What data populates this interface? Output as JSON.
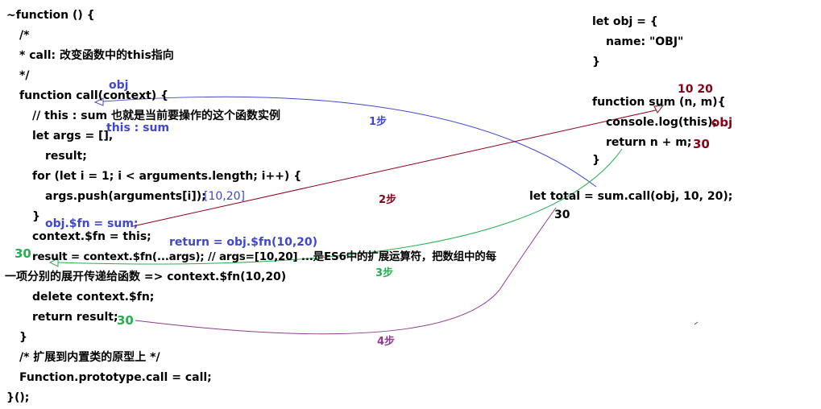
{
  "code_left": [
    "~function () {",
    "/*",
    " *  call: 改变函数中的this指向",
    " */",
    "function call(context) {",
    "// this : sum 也就是当前要操作的这个函数实例",
    "let args = [],",
    "result;",
    "for (let i = 1; i < arguments.length; i++) {",
    "args.push(arguments[i]);",
    "}",
    "context.$fn = this;",
    "result = context.$fn(...args);  // args=[10,20] ...是ES6中的扩展运算符，把数组中的每",
    "一项分别的展开传递给函数 => context.$fn(10,20)",
    "delete context.$fn;",
    "return result;",
    "}",
    "/* 扩展到内置类的原型上 */",
    "Function.prototype.call = call;",
    "}();"
  ],
  "code_right": [
    "let obj = {",
    "name: \"OBJ\"",
    "}",
    "function sum (n, m){",
    "console.log(this);",
    "return n + m;",
    "}",
    "let total = sum.call(obj, 10, 20);"
  ],
  "annotations": {
    "obj_over_context": "obj",
    "this_sum": "this : sum",
    "args_array": "[10,20]",
    "obj_fn_sum": "obj.$fn = sum;",
    "return_obj_fn": "return = obj.$fn(10,20)",
    "result_30": "30",
    "return_30": "30",
    "params_10_20": "10 20",
    "console_obj": "obj",
    "sum_30": "30",
    "total_30": "30"
  },
  "steps": {
    "step1": "1步",
    "step2": "2步",
    "step3": "3步",
    "step4": "4步"
  },
  "colors": {
    "code": "#000000",
    "step1": "#3f48cc",
    "step2": "#8b0016",
    "step3": "#22b14c",
    "step4": "#8e3b8e"
  }
}
